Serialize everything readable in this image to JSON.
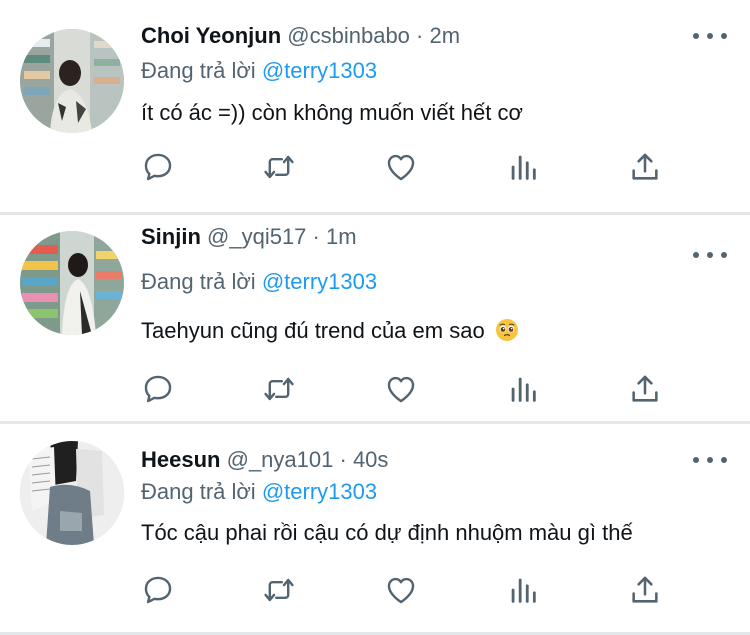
{
  "colors": {
    "accent": "#1d9bf0",
    "secondary_text": "#536471",
    "primary_text": "#0f1419",
    "separator": "#e4e7ea"
  },
  "tweets": [
    {
      "name": "Choi Yeonjun",
      "handle": "@csbinbabo",
      "dot": "·",
      "time": "2m",
      "reply_prefix": "Đang trả lời",
      "reply_to": "@terry1303",
      "text": "ít có ác =)) còn không muốn viết hết cơ",
      "actions": [
        "reply-icon",
        "retweet-icon",
        "like-icon",
        "analytics-icon",
        "share-icon"
      ]
    },
    {
      "name": "Sinjin",
      "handle": "@_yqi517",
      "dot": "·",
      "time": "1m",
      "reply_prefix": "Đang trả lời",
      "reply_to": "@terry1303",
      "text": "Taehyun cũng đú trend của em sao",
      "emoji": "pleading-face-emoji",
      "actions": [
        "reply-icon",
        "retweet-icon",
        "like-icon",
        "analytics-icon",
        "share-icon"
      ]
    },
    {
      "name": "Heesun",
      "handle": "@_nya101",
      "dot": "·",
      "time": "40s",
      "reply_prefix": "Đang trả lời",
      "reply_to": "@terry1303",
      "text": "Tóc cậu phai rồi cậu có dự định nhuộm màu gì thế",
      "actions": [
        "reply-icon",
        "retweet-icon",
        "like-icon",
        "analytics-icon",
        "share-icon"
      ]
    }
  ]
}
